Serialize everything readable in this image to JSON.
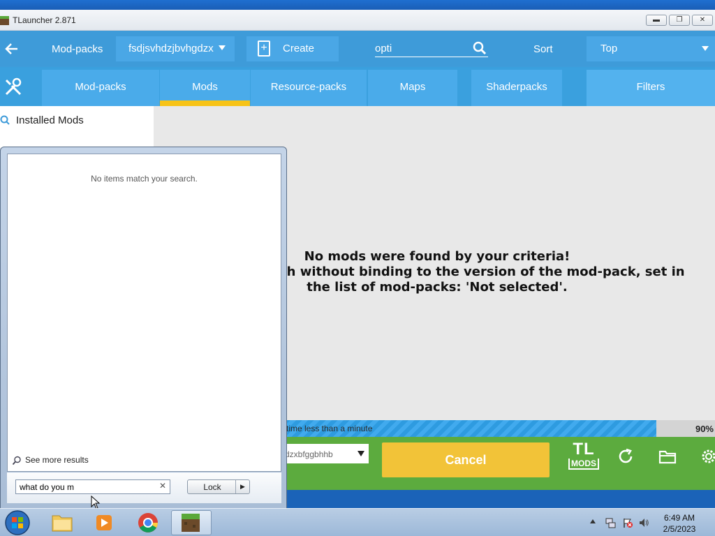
{
  "window": {
    "title": "TLauncher 2.871"
  },
  "toolbar1": {
    "modpacks_label": "Mod-packs",
    "modpack_select": "fsdjsvhdzjbvhgdzx",
    "create_label": "Create",
    "search_value": "opti",
    "sort_label": "Sort",
    "sort_select": "Top"
  },
  "tabs": [
    "Mod-packs",
    "Mods",
    "Resource-packs",
    "Maps",
    "Shaderpacks",
    "Filters"
  ],
  "active_tab": "Mods",
  "left_panel": {
    "installed_label": "Installed Mods"
  },
  "message": {
    "line1": "No mods were found by your criteria!",
    "line2": "ch without binding to the version of the mod-pack, set in",
    "line3": "the list of mod-packs: 'Not selected'."
  },
  "progress": {
    "text": "time less than a minute",
    "percent_label": "90%",
    "value": 0.9
  },
  "bottom_bar": {
    "version_select": "dzxbfggbhhb",
    "cancel_label": "Cancel",
    "logo_top": "TL",
    "logo_bottom": "MODS"
  },
  "start_menu": {
    "no_items": "No items match your search.",
    "see_more": "See more results",
    "search_value": "what do you m",
    "lock_label": "Lock"
  },
  "taskbar": {
    "time": "6:49 AM",
    "date": "2/5/2023"
  },
  "colors": {
    "accent_blue": "#3e9bd9",
    "tab_highlight": "#f7c317",
    "cancel_yellow": "#f2c338",
    "bottom_green": "#5cab3e"
  }
}
